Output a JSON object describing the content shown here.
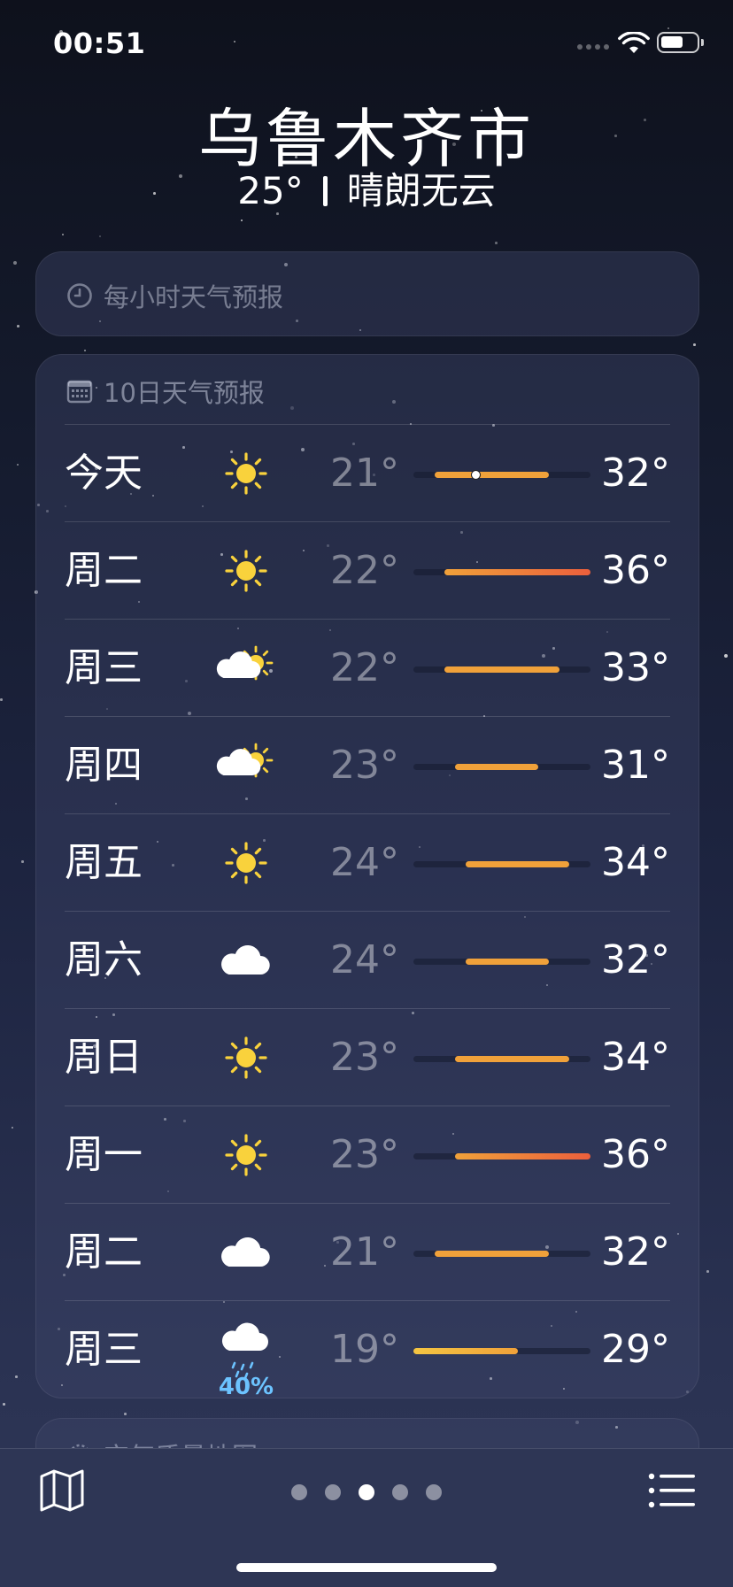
{
  "status_bar": {
    "time": "00:51"
  },
  "header": {
    "city": "乌鲁木齐市",
    "current_temp": "25°",
    "condition": "晴朗无云"
  },
  "hourly_card": {
    "title": "每小时天气预报"
  },
  "daily_card": {
    "title": "10日天气预报",
    "scale_min": 19,
    "scale_max": 36,
    "current_temp_value": 25,
    "days": [
      {
        "day": "今天",
        "icon": "sun-icon",
        "low": "21°",
        "high": "32°",
        "low_value": 21,
        "high_value": 32,
        "show_current": true
      },
      {
        "day": "周二",
        "icon": "sun-icon",
        "low": "22°",
        "high": "36°",
        "low_value": 22,
        "high_value": 36
      },
      {
        "day": "周三",
        "icon": "partly-cloudy-icon",
        "low": "22°",
        "high": "33°",
        "low_value": 22,
        "high_value": 33
      },
      {
        "day": "周四",
        "icon": "partly-cloudy-icon",
        "low": "23°",
        "high": "31°",
        "low_value": 23,
        "high_value": 31
      },
      {
        "day": "周五",
        "icon": "sun-icon",
        "low": "24°",
        "high": "34°",
        "low_value": 24,
        "high_value": 34
      },
      {
        "day": "周六",
        "icon": "cloud-icon",
        "low": "24°",
        "high": "32°",
        "low_value": 24,
        "high_value": 32
      },
      {
        "day": "周日",
        "icon": "sun-icon",
        "low": "23°",
        "high": "34°",
        "low_value": 23,
        "high_value": 34
      },
      {
        "day": "周一",
        "icon": "sun-icon",
        "low": "23°",
        "high": "36°",
        "low_value": 23,
        "high_value": 36
      },
      {
        "day": "周二",
        "icon": "cloud-icon",
        "low": "21°",
        "high": "32°",
        "low_value": 21,
        "high_value": 32
      },
      {
        "day": "周三",
        "icon": "rain-icon",
        "low": "19°",
        "high": "29°",
        "low_value": 19,
        "high_value": 29,
        "precip": "40%"
      }
    ]
  },
  "air_quality_card": {
    "title": "空气质量地图"
  },
  "bottom_bar": {
    "page_count": 5,
    "active_page": 3
  },
  "colors": {
    "sun": "#f9d23c",
    "precip": "#6cc3ff",
    "bar_cool": "#f4c542",
    "bar_warm": "#f0a13a",
    "bar_hot": "#ec5f3c"
  }
}
